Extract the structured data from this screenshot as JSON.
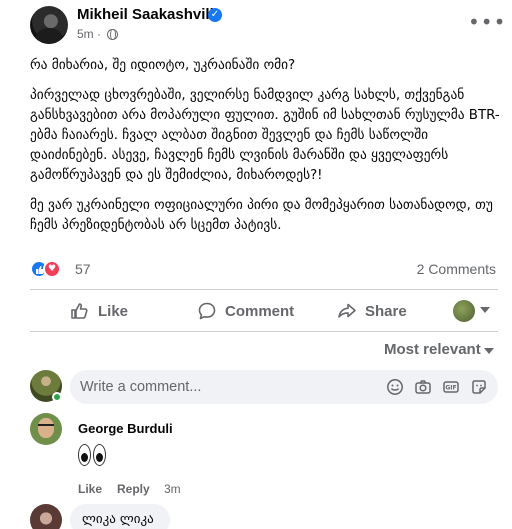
{
  "post": {
    "author": "Mikheil Saakashvili",
    "time": "5m · ",
    "paragraphs": [
      "რა მიხარია, შე იდიოტო, უკრაინაში ომი?",
      "პირველად ცხოვრებაში, ველირსე ნამდვილ კარგ სახლს, თქვენგან განსხვავებით არა მოპარული ფულით. გუშინ იმ სახლთან რუსულმა BTR-ებმა ჩაიარეს. ჩვალ ალბათ შიგნით შევლენ და ჩემს საწოლში დაიძინებენ. ასევე, ჩავლენ ჩემს ლვინის მარანში და ყველაფერს გამოწრუპავენ და ეს შემიძლია, მიხაროდეს?!",
      "მე ვარ უკრაინელი ოფიციალური პირი და მომეპყარით სათანადოდ, თუ ჩემს პრეზიდენტობას არ სცემთ პატივს."
    ],
    "reaction_count": "57",
    "comment_count": "2 Comments"
  },
  "actions": {
    "like": "Like",
    "comment": "Comment",
    "share": "Share"
  },
  "comments_section": {
    "sort_label": "Most relevant",
    "input_placeholder": "Write a comment...",
    "comments": [
      {
        "author": "George Burduli",
        "content": "👀",
        "like": "Like",
        "reply": "Reply",
        "time": "3m"
      },
      {
        "content": "ლიკა ლიკა"
      }
    ]
  },
  "colors": {
    "accent": "#1877f2",
    "love": "#f33e58",
    "secondary_text": "#65676b",
    "input_bg": "#f0f2f5",
    "online": "#31a24c"
  },
  "icons": [
    "globe-icon",
    "verified-icon",
    "more-icon",
    "like-icon",
    "comment-icon",
    "share-icon",
    "emoji-icon",
    "camera-icon",
    "gif-icon",
    "sticker-icon"
  ]
}
